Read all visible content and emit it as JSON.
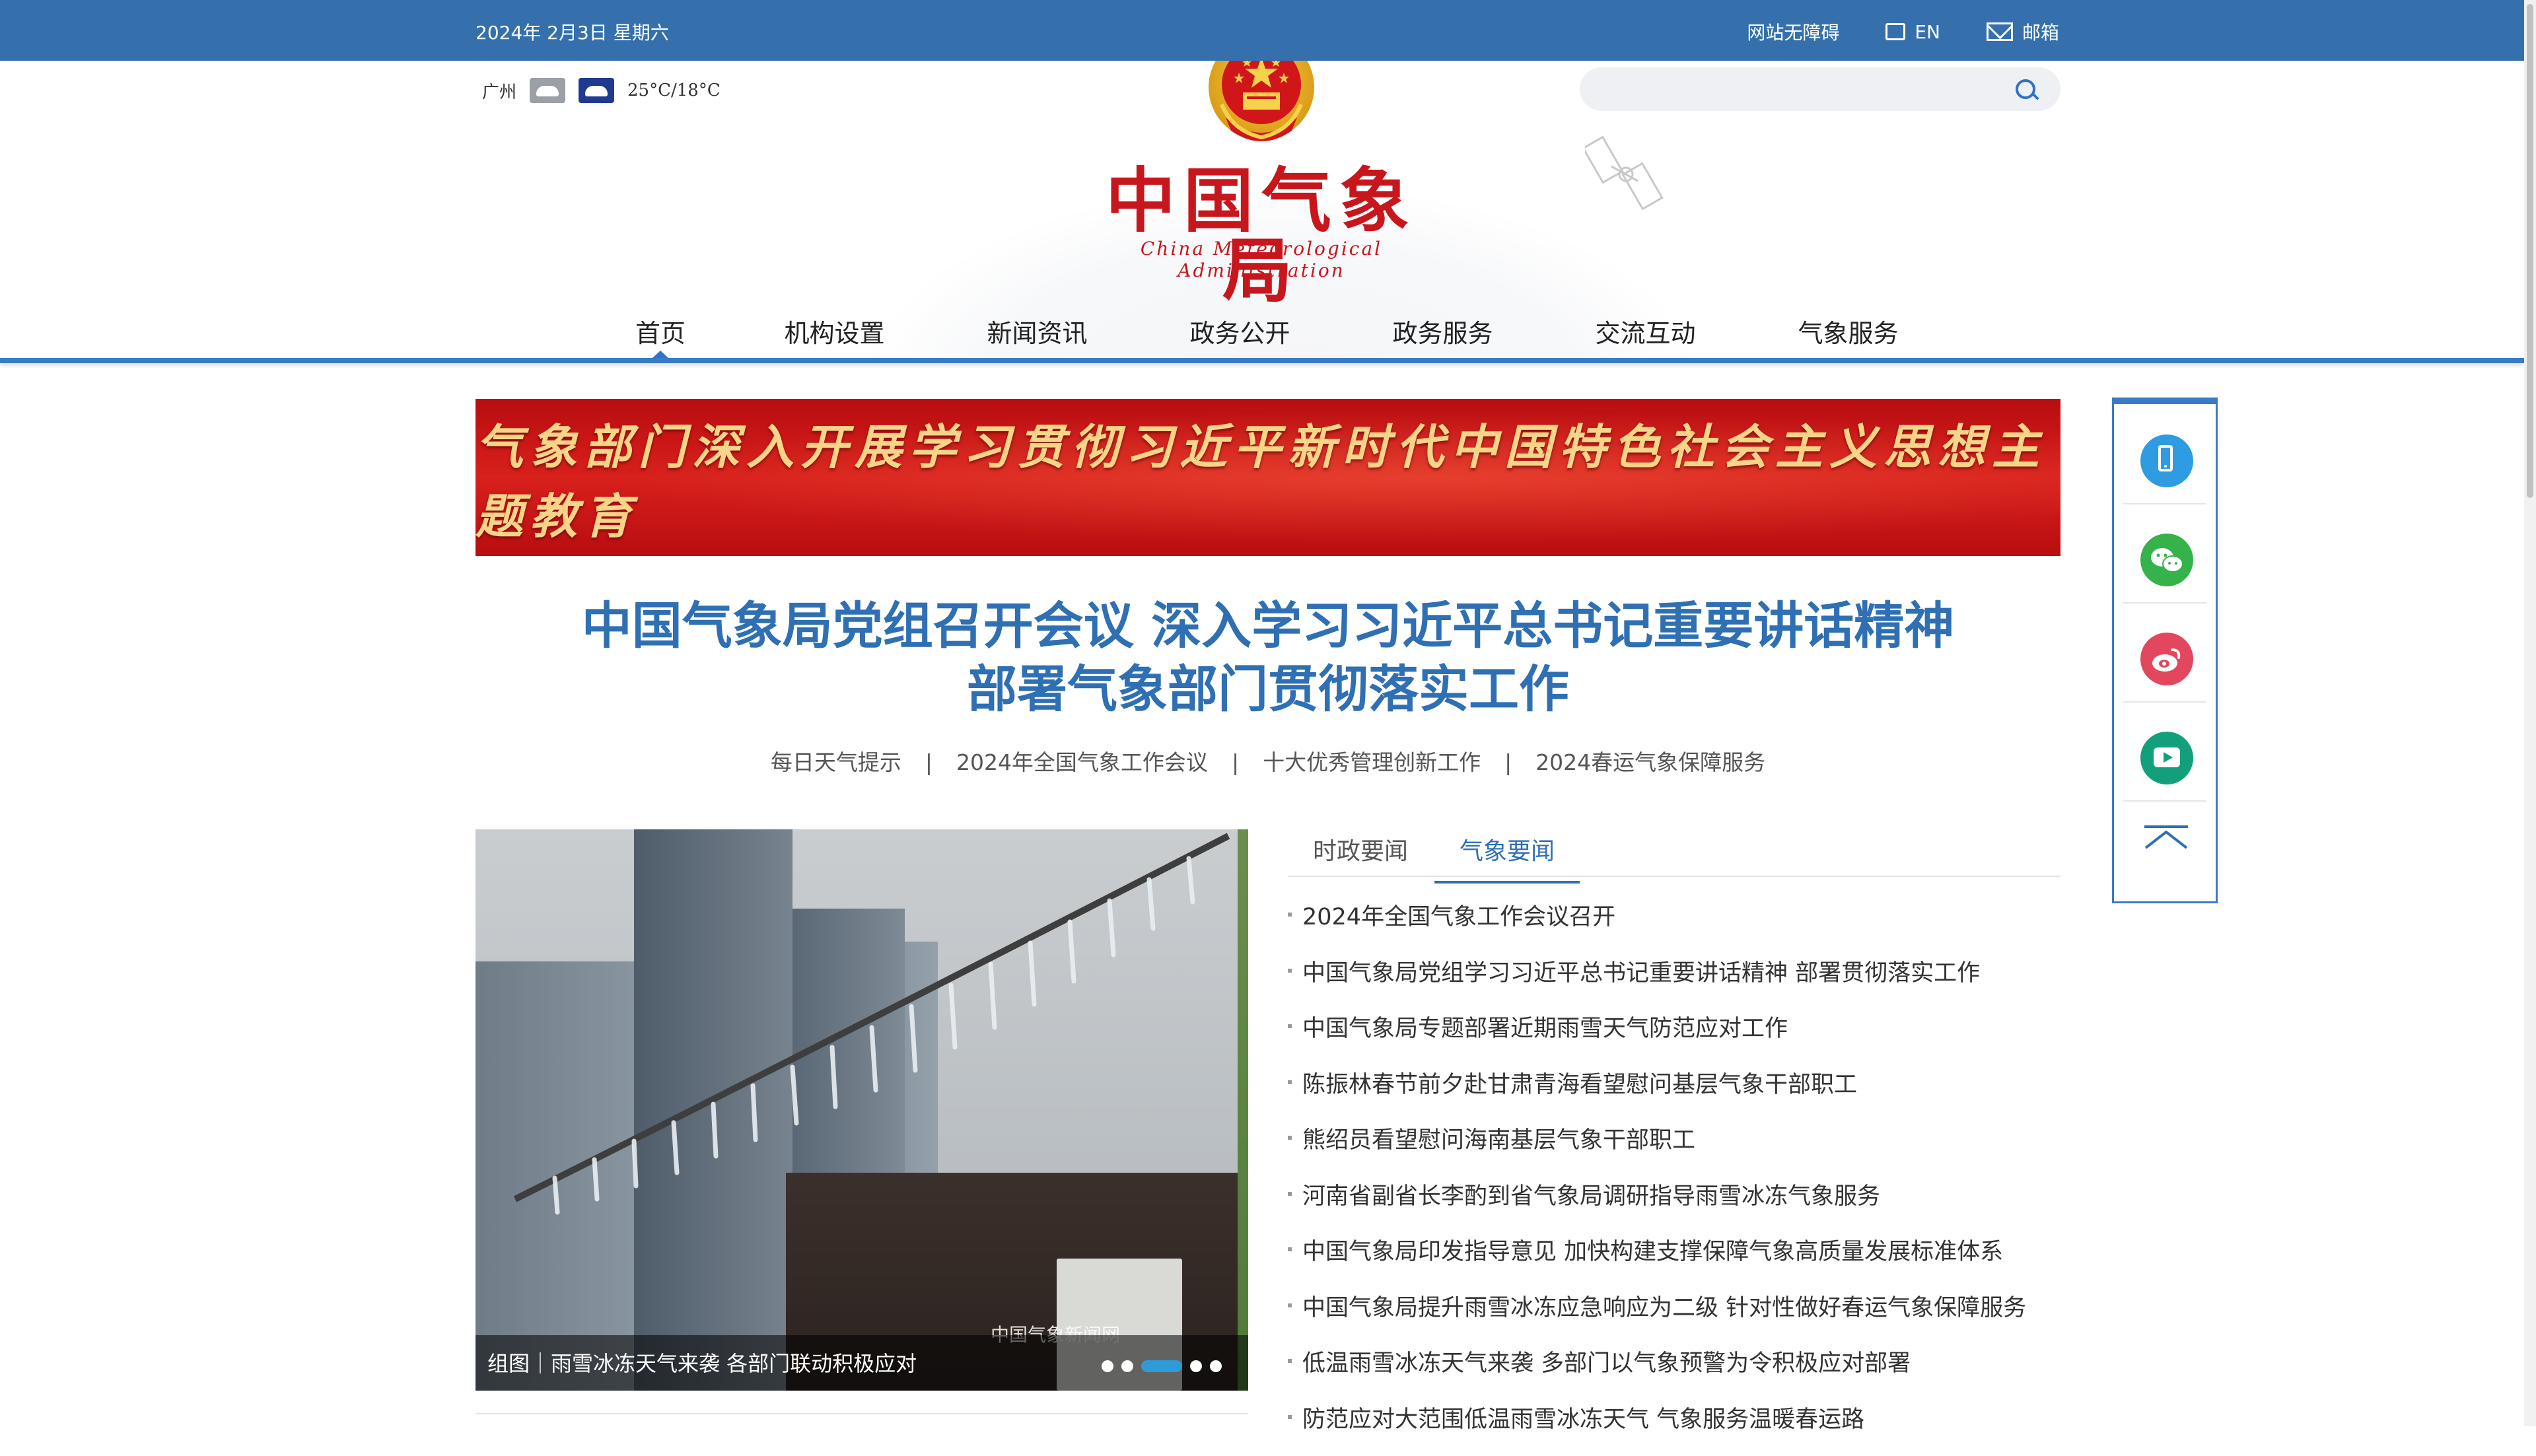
{
  "topbar": {
    "date": "2024年  2月3日  星期六",
    "accessibility": "网站无障碍",
    "english": "EN",
    "mail": "邮箱"
  },
  "weather": {
    "city": "广州",
    "day_icon": "cloudy-icon",
    "night_icon": "cloudy-night-icon",
    "temp": "25°C/18°C"
  },
  "search": {
    "placeholder": ""
  },
  "logo": {
    "cn": "中国气象局",
    "en": "China Meteorological Administration"
  },
  "nav": {
    "items": [
      "首页",
      "机构设置",
      "新闻资讯",
      "政务公开",
      "政务服务",
      "交流互动",
      "气象服务"
    ],
    "active": "首页"
  },
  "banner": {
    "text": "气象部门深入开展学习贯彻习近平新时代中国特色社会主义思想主题教育"
  },
  "headline": {
    "line1": "中国气象局党组召开会议 深入学习习近平总书记重要讲话精神",
    "line2": "部署气象部门贯彻落实工作"
  },
  "sublinks": [
    "每日天气提示",
    "2024年全国气象工作会议",
    "十大优秀管理创新工作",
    "2024春运气象保障服务"
  ],
  "carousel": {
    "caption": "组图｜雨雪冰冻天气来袭 各部门联动积极应对",
    "watermark": "中国气象新闻网",
    "slide_count": 5,
    "active_slide": 3
  },
  "news": {
    "tabs": [
      "时政要闻",
      "气象要闻"
    ],
    "active_tab": "气象要闻",
    "items": [
      "2024年全国气象工作会议召开",
      "中国气象局党组学习习近平总书记重要讲话精神 部署贯彻落实工作",
      "中国气象局专题部署近期雨雪天气防范应对工作",
      "陈振林春节前夕赴甘肃青海看望慰问基层气象干部职工",
      "熊绍员看望慰问海南基层气象干部职工",
      "河南省副省长李酌到省气象局调研指导雨雪冰冻气象服务",
      "中国气象局印发指导意见 加快构建支撑保障气象高质量发展标准体系",
      "中国气象局提升雨雪冰冻应急响应为二级 针对性做好春运气象保障服务",
      "低温雨雪冰冻天气来袭 多部门以气象预警为令积极应对部署",
      "防范应对大范围低温雨雪冰冻天气 气象服务温暖春运路"
    ]
  },
  "float_panel": {
    "items": [
      "phone-icon",
      "wechat-icon",
      "weibo-icon",
      "video-icon",
      "back-to-top-icon"
    ]
  },
  "colors": {
    "topbar": "#3570ad",
    "accent": "#2f6fb3",
    "logo_red": "#c8161d",
    "banner_red": "#c8161d",
    "banner_text": "#f6d488"
  }
}
